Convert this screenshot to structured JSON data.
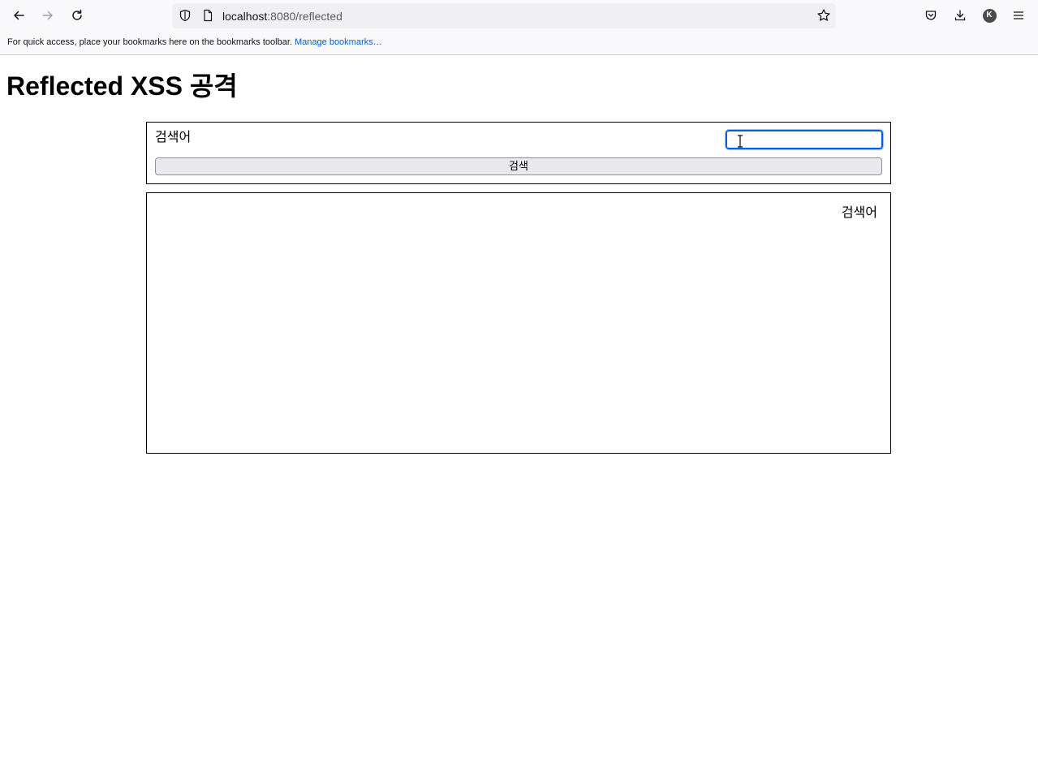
{
  "browser": {
    "url_host": "localhost",
    "url_path": ":8080/reflected",
    "bookmarks_text": "For quick access, place your bookmarks here on the bookmarks toolbar.",
    "bookmarks_link": "Manage bookmarks…",
    "account_initial": "K"
  },
  "page": {
    "title": "Reflected XSS 공격",
    "search": {
      "label": "검색어",
      "input_value": "",
      "button_label": "검색"
    },
    "result": {
      "text": "검색어"
    }
  },
  "colors": {
    "focus_ring": "#0060df",
    "link": "#0061e0",
    "button_bg": "#e9e9ed"
  }
}
